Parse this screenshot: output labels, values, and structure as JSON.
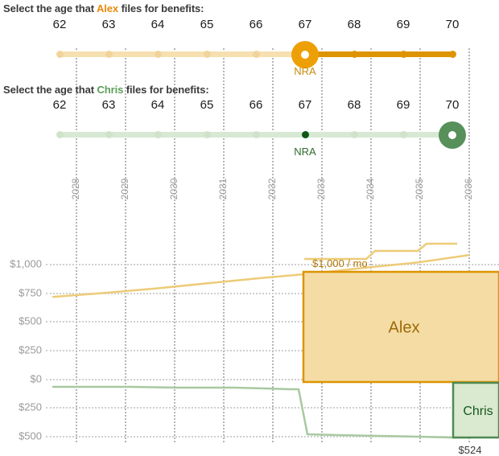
{
  "prompts": {
    "alex": {
      "pre": "Select the age that ",
      "name": "Alex",
      "post": " files for benefits:",
      "name_color": "#e8890c"
    },
    "chris": {
      "pre": "Select the age that ",
      "name": "Chris",
      "post": " files for benefits:",
      "name_color": "#5b9e5b"
    }
  },
  "sliders": [
    {
      "person": "Alex",
      "ages": [
        "62",
        "63",
        "64",
        "65",
        "66",
        "67",
        "68",
        "69",
        "70"
      ],
      "selected_age": "67",
      "nra_label": "NRA",
      "nra_age": "67",
      "accent": "#dd9400",
      "track_light": "#f6e0b0"
    },
    {
      "person": "Chris",
      "ages": [
        "62",
        "63",
        "64",
        "65",
        "66",
        "67",
        "68",
        "69",
        "70"
      ],
      "selected_age": "70",
      "nra_label": "NRA",
      "nra_age": "67",
      "accent": "#57905a",
      "track_light": "#d7e8d3"
    }
  ],
  "chart_data": {
    "type": "line",
    "title": "",
    "xlabel": "",
    "ylabel": "",
    "x_tick_labels": [
      "2028",
      "2029",
      "2030",
      "2031",
      "2032",
      "2033",
      "2034",
      "2035",
      "2036"
    ],
    "y_tick_labels": [
      "$1,000",
      "$750",
      "$500",
      "$250",
      "$0",
      "$250",
      "$500"
    ],
    "y_tick_values": [
      1000,
      750,
      500,
      250,
      0,
      -250,
      -500
    ],
    "ylim": [
      -625,
      1125
    ],
    "grid": true,
    "legend_position": "inline-labels",
    "annotations": [
      {
        "name": "alex-rate-label",
        "text": "$1,000 / mo",
        "color": "#b07a09"
      },
      {
        "name": "alex-area-label",
        "text": "Alex",
        "color": "#9c6b07"
      },
      {
        "name": "chris-area-label",
        "text": "Chris",
        "color": "#17561d"
      },
      {
        "name": "chris-rate-label",
        "text": "$524",
        "color": "#3a3a3a"
      }
    ],
    "series": [
      {
        "name": "Alex",
        "color": "#edcb78",
        "x": [
          "2028",
          "2029",
          "2030",
          "2031",
          "2032",
          "2033",
          "2034",
          "2035",
          "2036"
        ],
        "values": [
          710,
          745,
          785,
          830,
          875,
          915,
          965,
          1010,
          1075
        ]
      },
      {
        "name": "Chris",
        "color": "#a8c9a0",
        "x": [
          "2028",
          "2029",
          "2030",
          "2031",
          "2032",
          "2033",
          "2034",
          "2035",
          "2036"
        ],
        "values": [
          -62,
          -68,
          -72,
          -80,
          -85,
          -300,
          -320,
          -340,
          -360
        ]
      }
    ],
    "areas": [
      {
        "name": "Alex",
        "fill": "#f5dca5",
        "stroke": "#dd9400",
        "value": 1000,
        "label": "Alex",
        "start_year": "2033",
        "end_year": "2036"
      },
      {
        "name": "Chris",
        "fill": "#d9ead0",
        "stroke": "#4f8a52",
        "value": -524,
        "label": "Chris",
        "start_year": "2036",
        "end_year": "2036"
      }
    ]
  },
  "colors": {
    "alex_accent": "#dd9400",
    "chris_accent": "#57905a",
    "gridline": "#cfcfcf",
    "vertical_gridline": "#b6b6b6",
    "axis_text": "#9a9a9a",
    "heading_text": "#3a3a3a"
  }
}
